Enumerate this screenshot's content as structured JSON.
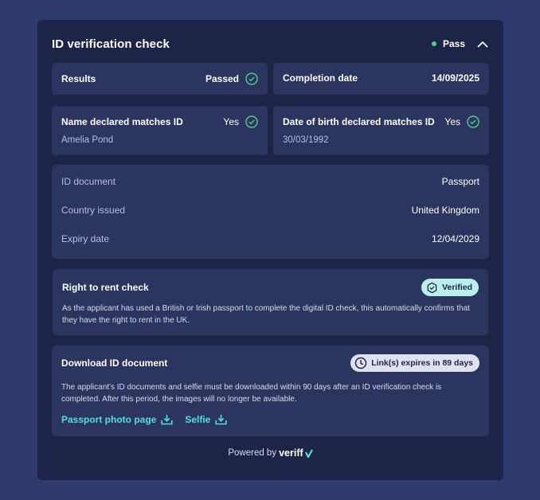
{
  "header": {
    "title": "ID verification check",
    "status": "Pass",
    "collapse_icon": "chevron-up-icon"
  },
  "results": {
    "label": "Results",
    "value": "Passed"
  },
  "completion": {
    "label": "Completion date",
    "value": "14/09/2025"
  },
  "name_match": {
    "label": "Name declared matches ID",
    "value": "Yes",
    "name": "Amelia Pond"
  },
  "dob_match": {
    "label": "Date of birth declared matches ID",
    "value": "Yes",
    "dob": "30/03/1992"
  },
  "document": {
    "rows": [
      {
        "key": "ID document",
        "value": "Passport"
      },
      {
        "key": "Country issued",
        "value": "United Kingdom"
      },
      {
        "key": "Expiry date",
        "value": "12/04/2029"
      }
    ]
  },
  "right_to_rent": {
    "title": "Right to rent check",
    "badge": "Verified",
    "text": "As the applicant has used a British or Irish passport to complete the digital ID check, this automatically confirms that they have the right to rent in the UK."
  },
  "download": {
    "title": "Download ID document",
    "badge": "Link(s) expires in 89 days",
    "text": "The applicant's ID documents and selfie must be downloaded within 90 days after an ID verification check is completed. After this period, the images will no longer be available.",
    "links": [
      "Passport photo page",
      "Selfie"
    ]
  },
  "footer": {
    "powered": "Powered by",
    "brand": "veriff"
  },
  "colors": {
    "background": "#2f3a6e",
    "card": "#1e2448",
    "panel": "#2c3460",
    "accent": "#52e0d4",
    "success": "#4fcf86"
  }
}
